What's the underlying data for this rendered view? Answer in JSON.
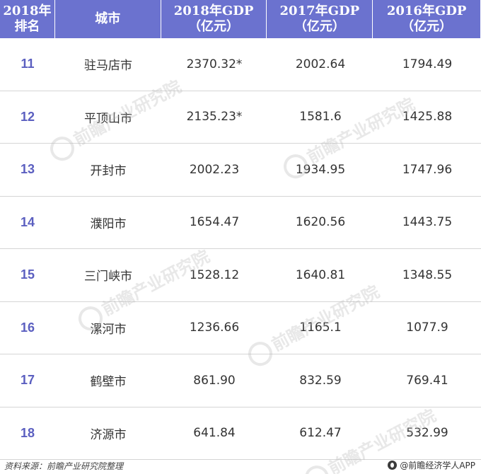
{
  "table": {
    "headers": [
      {
        "line1": "2018年",
        "line2": "排名"
      },
      {
        "line1": "城市",
        "line2": ""
      },
      {
        "line1": "2018年GDP",
        "line2": "（亿元）"
      },
      {
        "line1": "2017年GDP",
        "line2": "（亿元）"
      },
      {
        "line1": "2016年GDP",
        "line2": "（亿元）"
      }
    ],
    "rows": [
      {
        "rank": "11",
        "city": "驻马店市",
        "gdp2018": "2370.32*",
        "gdp2017": "2002.64",
        "gdp2016": "1794.49"
      },
      {
        "rank": "12",
        "city": "平顶山市",
        "gdp2018": "2135.23*",
        "gdp2017": "1581.6",
        "gdp2016": "1425.88"
      },
      {
        "rank": "13",
        "city": "开封市",
        "gdp2018": "2002.23",
        "gdp2017": "1934.95",
        "gdp2016": "1747.96"
      },
      {
        "rank": "14",
        "city": "濮阳市",
        "gdp2018": "1654.47",
        "gdp2017": "1620.56",
        "gdp2016": "1443.75"
      },
      {
        "rank": "15",
        "city": "三门峡市",
        "gdp2018": "1528.12",
        "gdp2017": "1640.81",
        "gdp2016": "1348.55"
      },
      {
        "rank": "16",
        "city": "漯河市",
        "gdp2018": "1236.66",
        "gdp2017": "1165.1",
        "gdp2016": "1077.9"
      },
      {
        "rank": "17",
        "city": "鹤壁市",
        "gdp2018": "861.90",
        "gdp2017": "832.59",
        "gdp2016": "769.41"
      },
      {
        "rank": "18",
        "city": "济源市",
        "gdp2018": "641.84",
        "gdp2017": "612.47",
        "gdp2016": "532.99"
      }
    ]
  },
  "watermark": {
    "text": "前瞻产业研究院"
  },
  "footer": {
    "source": "资料来源：前瞻产业研究院整理",
    "brand": "@前瞻经济学人APP"
  },
  "colors": {
    "header_bg": "#6b72cf",
    "rank_text": "#5b5fc0"
  }
}
